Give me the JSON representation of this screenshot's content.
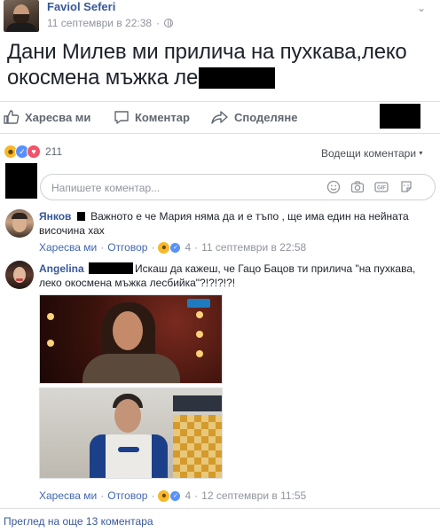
{
  "post": {
    "author": "Faviol Seferi",
    "date": "11 септември в 22:38",
    "text_line1": "Дани Милев ми прилича на пухкава,леко",
    "text_line2": "окосмена мъжка ле",
    "visibility_icon": "globe-icon",
    "options_icon": "chevron-down-icon"
  },
  "actions": {
    "like": "Харесва ми",
    "comment": "Коментар",
    "share": "Споделяне"
  },
  "reactions": {
    "count": "211",
    "icons": [
      "haha",
      "like",
      "love"
    ],
    "sort_label": "Водещи коментари"
  },
  "composer": {
    "placeholder": "Напишете коментар...",
    "icons": [
      "emoji-icon",
      "camera-icon",
      "gif-icon",
      "sticker-icon"
    ]
  },
  "comments": [
    {
      "author": "Янков",
      "text": "Важното е че Мария няма да и е тъпо , ще има един на нейната височина хах",
      "like": "Харесва ми",
      "reply": "Отговор",
      "reaction_count": "4",
      "date": "11 септември в 22:58"
    },
    {
      "author": "Angelina",
      "text": "Искаш да кажеш, че Гацо Бацов ти прилича \"на пухкава, леко окосмена мъжка лесбийка\"?!?!?!?!",
      "like": "Харесва ми",
      "reply": "Отговор",
      "reaction_count": "4",
      "date": "12 септември в 11:55"
    }
  ],
  "view_more": "Преглед на още 13 коментара",
  "colors": {
    "link": "#385898",
    "meta": "#90949c",
    "divider": "#dddfe2",
    "accent": "#4267b2"
  }
}
